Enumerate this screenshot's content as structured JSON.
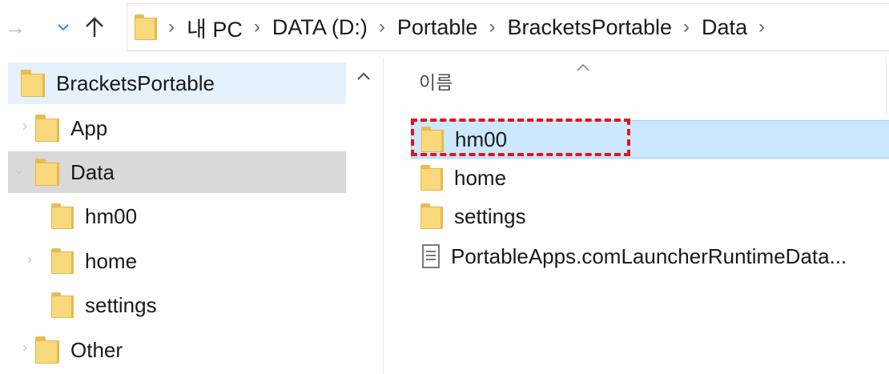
{
  "address_bar": {
    "back_glyph": "→",
    "breadcrumbs": [
      "내 PC",
      "DATA (D:)",
      "Portable",
      "BracketsPortable",
      "Data"
    ],
    "separator": "›"
  },
  "nav_pane": {
    "items": [
      {
        "label": "BracketsPortable",
        "state": "selected"
      },
      {
        "label": "App",
        "expander": "›"
      },
      {
        "label": "Data",
        "state": "hover",
        "expander": "⌄"
      },
      {
        "label": "hm00"
      },
      {
        "label": "home",
        "expander": "›"
      },
      {
        "label": "settings"
      },
      {
        "label": "Other",
        "expander": "›"
      }
    ]
  },
  "file_list": {
    "column_header": "이름",
    "items": [
      {
        "label": "hm00",
        "type": "folder",
        "state": "selected"
      },
      {
        "label": "home",
        "type": "folder"
      },
      {
        "label": "settings",
        "type": "folder"
      },
      {
        "label": "PortableApps.comLauncherRuntimeData...",
        "type": "file"
      }
    ]
  },
  "colors": {
    "selection": "#cce8ff",
    "nav_selected": "#e5f1fb",
    "nav_hover": "#d9d9d9",
    "folder": "#f9d97c",
    "highlight": "#e0151b"
  }
}
